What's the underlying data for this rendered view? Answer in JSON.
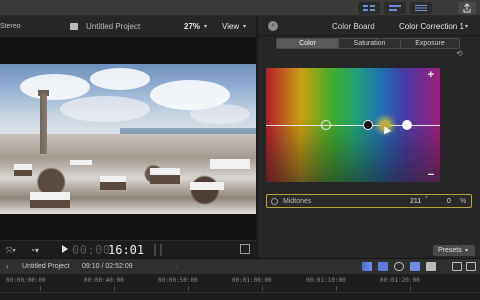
{
  "viewer": {
    "audio_label": "Stereo",
    "project_title": "Untitled Project",
    "zoom": "27%",
    "view_menu": "View"
  },
  "transport": {
    "timecode_dim": "00:00",
    "timecode": "16:01"
  },
  "inspector": {
    "board_title": "Color Board",
    "correction": "Color Correction 1",
    "tabs": [
      "Color",
      "Saturation",
      "Exposure"
    ],
    "active_tab": "Color",
    "midtones": {
      "label": "Midtones",
      "hue": "211",
      "hue_unit": "°",
      "amount": "0",
      "amount_unit": "%"
    },
    "presets_label": "Presets"
  },
  "timeline": {
    "project_name": "Untitled Project",
    "duration": "09:10 / 02:52:09",
    "ruler_labels": [
      "00:00:00:00",
      "00:00:40:00",
      "00:00:50:00",
      "00:01:00:00",
      "00:01:10:00",
      "00:01:20:00"
    ]
  },
  "icons": {
    "back": "‹",
    "plus": "+",
    "minus": "−",
    "reset": "⟲"
  }
}
